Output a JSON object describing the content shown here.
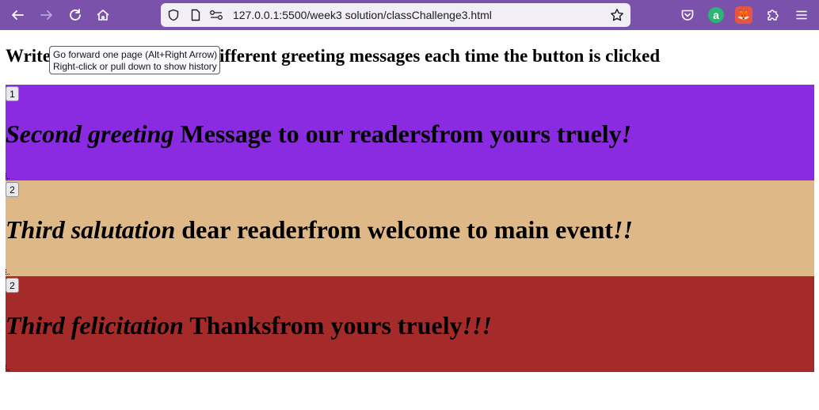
{
  "browser": {
    "url": "127.0.0.1:5500/week3 solution/classChallenge3.html",
    "toolbar_color": "#7b52ab",
    "icons": [
      "back-arrow-icon",
      "forward-arrow-icon",
      "reload-icon",
      "home-icon",
      "shield-icon",
      "page-icon",
      "permissions-icon",
      "star-icon",
      "pocket-icon",
      "extension-a-icon",
      "extension-fox-icon",
      "extensions-puzzle-icon",
      "menu-icon"
    ],
    "extension_a_letter": "a",
    "extension_fox_glyph": "🦊"
  },
  "tooltip": {
    "line1": "Go forward one page (Alt+Right Arrow)",
    "line2": "Right-click or pull down to show history"
  },
  "page": {
    "heading_visible": "Write",
    "heading_rest": "e around 5 different greeting messages each time the button is clicked"
  },
  "cards": [
    {
      "button": "1",
      "title": "Second greeting",
      "message": " Message to our readersfrom yours truely",
      "punct": "!",
      "bg": "#8a2be2"
    },
    {
      "button": "2",
      "title": "Third salutation",
      "message": " dear readerfrom welcome to main event",
      "punct": "!!",
      "bg": "#deb887"
    },
    {
      "button": "2",
      "title": "Third felicitation",
      "message": " Thanksfrom yours truely",
      "punct": "!!!",
      "bg": "#a52a2a"
    }
  ]
}
